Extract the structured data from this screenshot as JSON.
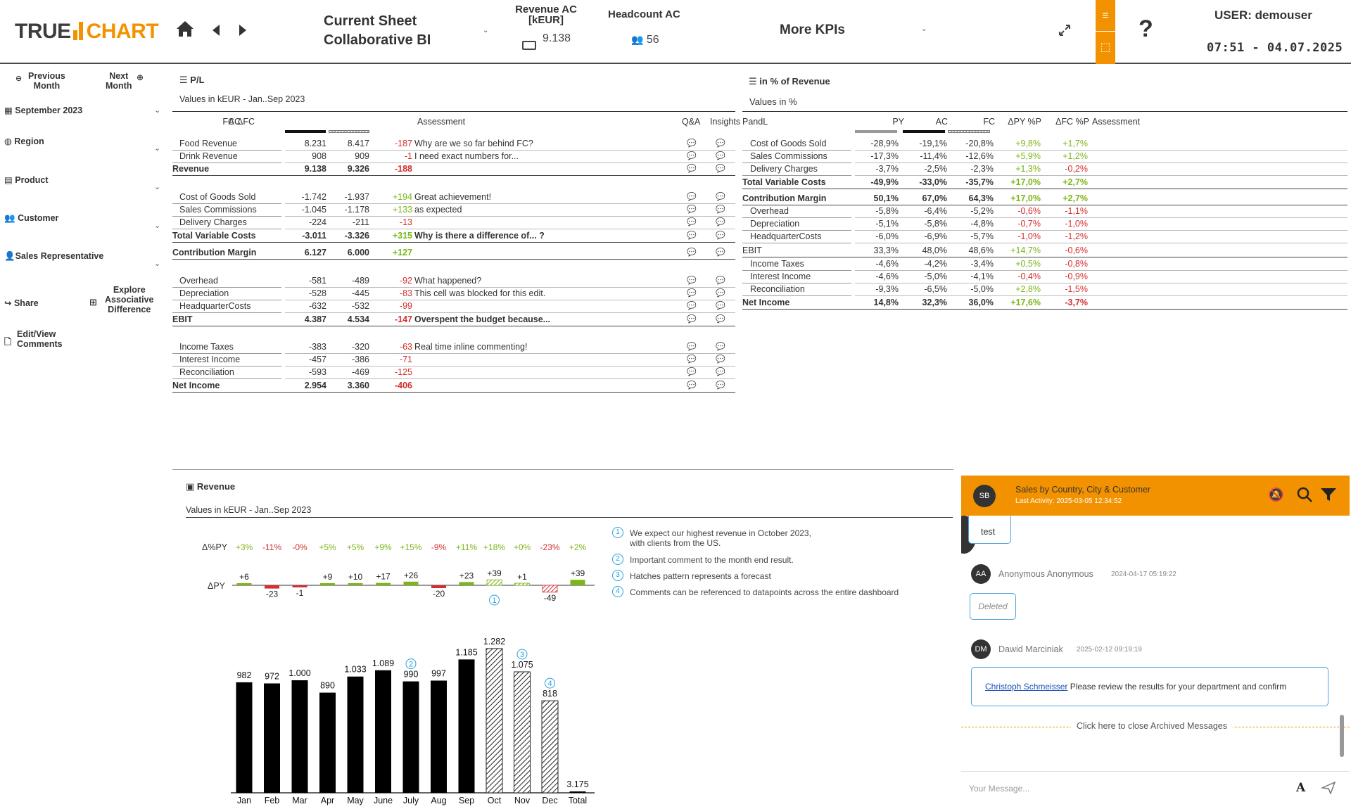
{
  "header": {
    "logo_left": "TRUE",
    "logo_right": "CHART",
    "sheet_title_line1": "Current Sheet",
    "sheet_title_line2": "Collaborative BI",
    "kpi1_title_line1": "Revenue AC",
    "kpi1_title_line2": "[kEUR]",
    "kpi1_value": "9.138",
    "kpi2_title": "Headcount AC",
    "kpi2_value": "56",
    "more_kpis": "More KPIs",
    "help": "?",
    "user": "USER: demouser",
    "time": "07:51 - 04.07.2025"
  },
  "sidebar": {
    "prev_month_1": "Previous",
    "prev_month_2": "Month",
    "next_month_1": "Next",
    "next_month_2": "Month",
    "month": "September 2023",
    "region": "Region",
    "product": "Product",
    "customer": "Customer",
    "sales_rep": "Sales Representative",
    "share": "Share",
    "explore_1": "Explore",
    "explore_2": "Associative",
    "explore_3": "Difference",
    "edit_1": "Edit/View",
    "edit_2": "Comments"
  },
  "pl": {
    "title": "P/L",
    "subtitle": "Values in kEUR - Jan..Sep 2023",
    "columns": [
      "AC",
      "FC",
      "ΔFC",
      "Assessment",
      "Q&A",
      "Insights"
    ],
    "rows": [
      {
        "label": "Food Revenue",
        "ac": "8.231",
        "fc": "8.417",
        "dfc": "-187",
        "assess": "Why are we so far behind FC?",
        "indent": true,
        "bold": false
      },
      {
        "label": "Drink Revenue",
        "ac": "908",
        "fc": "909",
        "dfc": "-1",
        "assess": "I need exact numbers for...",
        "indent": true,
        "bold": false
      },
      {
        "label": "Revenue",
        "ac": "9.138",
        "fc": "9.326",
        "dfc": "-188",
        "assess": "",
        "indent": false,
        "bold": true
      },
      {
        "label": "Cost of Goods Sold",
        "ac": "-1.742",
        "fc": "-1.937",
        "dfc": "+194",
        "assess": "Great achievement!",
        "indent": true,
        "bold": false
      },
      {
        "label": "Sales Commissions",
        "ac": "-1.045",
        "fc": "-1.178",
        "dfc": "+133",
        "assess": "as expected",
        "indent": true,
        "bold": false
      },
      {
        "label": "Delivery Charges",
        "ac": "-224",
        "fc": "-211",
        "dfc": "-13",
        "assess": "",
        "indent": true,
        "bold": false
      },
      {
        "label": "Total Variable Costs",
        "ac": "-3.011",
        "fc": "-3.326",
        "dfc": "+315",
        "assess": "Why is there a difference of... ?",
        "indent": false,
        "bold": true
      },
      {
        "label": "Contribution Margin",
        "ac": "6.127",
        "fc": "6.000",
        "dfc": "+127",
        "assess": "",
        "indent": false,
        "bold": true
      },
      {
        "label": "Overhead",
        "ac": "-581",
        "fc": "-489",
        "dfc": "-92",
        "assess": "What happened?",
        "indent": true,
        "bold": false
      },
      {
        "label": "Depreciation",
        "ac": "-528",
        "fc": "-445",
        "dfc": "-83",
        "assess": "This cell was blocked for this edit.",
        "indent": true,
        "bold": false
      },
      {
        "label": "HeadquarterCosts",
        "ac": "-632",
        "fc": "-532",
        "dfc": "-99",
        "assess": "",
        "indent": true,
        "bold": false
      },
      {
        "label": "EBIT",
        "ac": "4.387",
        "fc": "4.534",
        "dfc": "-147",
        "assess": "Overspent the budget because...",
        "indent": false,
        "bold": true
      },
      {
        "label": "Income Taxes",
        "ac": "-383",
        "fc": "-320",
        "dfc": "-63",
        "assess": "Real time inline commenting!",
        "indent": true,
        "bold": false
      },
      {
        "label": "Interest Income",
        "ac": "-457",
        "fc": "-386",
        "dfc": "-71",
        "assess": "",
        "indent": true,
        "bold": false
      },
      {
        "label": "Reconciliation",
        "ac": "-593",
        "fc": "-469",
        "dfc": "-125",
        "assess": "",
        "indent": true,
        "bold": false
      },
      {
        "label": "Net Income",
        "ac": "2.954",
        "fc": "3.360",
        "dfc": "-406",
        "assess": "",
        "indent": false,
        "bold": true
      }
    ]
  },
  "pct": {
    "title": "in % of Revenue",
    "subtitle": "Values in %",
    "columns": [
      "PandL",
      "PY",
      "AC",
      "FC",
      "ΔPY %P",
      "ΔFC %P",
      "Assessment"
    ],
    "rows": [
      {
        "label": "Cost of Goods Sold",
        "py": "-28,9%",
        "ac": "-19,1%",
        "fc": "-20,8%",
        "dpy": "+9,8%",
        "dfc": "+1,7%",
        "indent": true,
        "bold": false
      },
      {
        "label": "Sales Commissions",
        "py": "-17,3%",
        "ac": "-11,4%",
        "fc": "-12,6%",
        "dpy": "+5,9%",
        "dfc": "+1,2%",
        "indent": true,
        "bold": false
      },
      {
        "label": "Delivery Charges",
        "py": "-3,7%",
        "ac": "-2,5%",
        "fc": "-2,3%",
        "dpy": "+1,3%",
        "dfc": "-0,2%",
        "indent": true,
        "bold": false
      },
      {
        "label": "Total Variable Costs",
        "py": "-49,9%",
        "ac": "-33,0%",
        "fc": "-35,7%",
        "dpy": "+17,0%",
        "dfc": "+2,7%",
        "indent": false,
        "bold": true
      },
      {
        "label": "Contribution Margin",
        "py": "50,1%",
        "ac": "67,0%",
        "fc": "64,3%",
        "dpy": "+17,0%",
        "dfc": "+2,7%",
        "indent": false,
        "bold": true
      },
      {
        "label": "Overhead",
        "py": "-5,8%",
        "ac": "-6,4%",
        "fc": "-5,2%",
        "dpy": "-0,6%",
        "dfc": "-1,1%",
        "indent": true,
        "bold": false
      },
      {
        "label": "Depreciation",
        "py": "-5,1%",
        "ac": "-5,8%",
        "fc": "-4,8%",
        "dpy": "-0,7%",
        "dfc": "-1,0%",
        "indent": true,
        "bold": false
      },
      {
        "label": "HeadquarterCosts",
        "py": "-6,0%",
        "ac": "-6,9%",
        "fc": "-5,7%",
        "dpy": "-1,0%",
        "dfc": "-1,2%",
        "indent": true,
        "bold": false
      },
      {
        "label": "EBIT",
        "py": "33,3%",
        "ac": "48,0%",
        "fc": "48,6%",
        "dpy": "+14,7%",
        "dfc": "-0,6%",
        "indent": false,
        "bold": false
      },
      {
        "label": "Income Taxes",
        "py": "-4,6%",
        "ac": "-4,2%",
        "fc": "-3,4%",
        "dpy": "+0,5%",
        "dfc": "-0,8%",
        "indent": true,
        "bold": false
      },
      {
        "label": "Interest Income",
        "py": "-4,6%",
        "ac": "-5,0%",
        "fc": "-4,1%",
        "dpy": "-0,4%",
        "dfc": "-0,9%",
        "indent": true,
        "bold": false
      },
      {
        "label": "Reconciliation",
        "py": "-9,3%",
        "ac": "-6,5%",
        "fc": "-5,0%",
        "dpy": "+2,8%",
        "dfc": "-1,5%",
        "indent": true,
        "bold": false
      },
      {
        "label": "Net Income",
        "py": "14,8%",
        "ac": "32,3%",
        "fc": "36,0%",
        "dpy": "+17,6%",
        "dfc": "-3,7%",
        "indent": false,
        "bold": true
      }
    ]
  },
  "revenue": {
    "title": "Revenue",
    "subtitle": "Values in kEUR - Jan..Sep 2023",
    "dpct_label": "Δ%PY",
    "dpy_label": "ΔPY",
    "notes": [
      {
        "num": "1",
        "text1": "We expect our highest revenue in October 2023,",
        "text2": "with clients from the US."
      },
      {
        "num": "2",
        "text1": "Important comment to the month end result.",
        "text2": ""
      },
      {
        "num": "3",
        "text1": "Hatches pattern represents a forecast",
        "text2": ""
      },
      {
        "num": "4",
        "text1": "Comments can be referenced to datapoints across the entire dashboard",
        "text2": ""
      }
    ]
  },
  "chart_data": {
    "type": "bar",
    "categories": [
      "Jan",
      "Feb",
      "Mar",
      "Apr",
      "May",
      "June",
      "July",
      "Aug",
      "Sep",
      "Oct",
      "Nov",
      "Dec",
      "Total"
    ],
    "values": [
      982,
      972,
      1000,
      890,
      1033,
      1089,
      990,
      997,
      1185,
      1282,
      1075,
      818,
      3175
    ],
    "value_labels": [
      "982",
      "972",
      "1.000",
      "890",
      "1.033",
      "1.089",
      "990",
      "997",
      "1.185",
      "1.282",
      "1.075",
      "818",
      "3.175"
    ],
    "forecast": [
      false,
      false,
      false,
      false,
      false,
      false,
      false,
      false,
      false,
      true,
      true,
      true,
      false
    ],
    "delta_py": [
      6,
      -23,
      -1,
      9,
      10,
      17,
      26,
      -20,
      23,
      39,
      1,
      -49,
      39
    ],
    "delta_py_labels": [
      "+6",
      "-23",
      "-1",
      "+9",
      "+10",
      "+17",
      "+26",
      "-20",
      "+23",
      "+39",
      "+1",
      "-49",
      "+39"
    ],
    "delta_pct_py": [
      "+3%",
      "-11%",
      "-0%",
      "+5%",
      "+5%",
      "+9%",
      "+15%",
      "-9%",
      "+11%",
      "+18%",
      "+0%",
      "-23%",
      "+2%"
    ],
    "markers": {
      "Oct": "1",
      "July": "2",
      "Nov": "3",
      "Dec": "4"
    }
  },
  "chat": {
    "avatar": "SB",
    "title": "Sales by Country, City & Customer",
    "subtitle": "Last Activity: 2025-03-05 12:34:52",
    "msg0_text": "test",
    "msg1_avatar": "AA",
    "msg1_name": "Anonymous Anonymous",
    "msg1_time": "2024-04-17 05:19:22",
    "msg1_text": "Deleted",
    "msg2_avatar": "DM",
    "msg2_name": "Dawid Marciniak",
    "msg2_time": "2025-02-12 09:19:19",
    "msg2_mention": "Christoph Schmeisser",
    "msg2_text": " Please review the results for your department and confirm",
    "archived": "Click here to close Archived Messages",
    "input_placeholder": "Your Message..."
  },
  "colors": {
    "accent": "#f39200",
    "negative": "#d32f2f",
    "positive": "#7cb518",
    "link": "#4aa3df"
  }
}
